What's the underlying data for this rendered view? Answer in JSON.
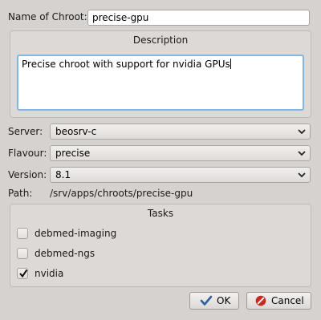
{
  "form": {
    "name_label": "Name of Chroot:",
    "name_value": "precise-gpu",
    "description_title": "Description",
    "description_value": "Precise chroot with support for nvidia GPUs",
    "server_label": "Server:",
    "server_value": "beosrv-c",
    "flavour_label": "Flavour:",
    "flavour_value": "precise",
    "version_label": "Version:",
    "version_value": "8.1",
    "path_label": "Path:",
    "path_value": "/srv/apps/chroots/precise-gpu"
  },
  "tasks": {
    "title": "Tasks",
    "items": [
      {
        "label": "debmed-imaging",
        "checked": false
      },
      {
        "label": "debmed-ngs",
        "checked": false
      },
      {
        "label": "nvidia",
        "checked": true
      }
    ]
  },
  "buttons": {
    "ok_label": "OK",
    "cancel_label": "Cancel"
  },
  "colors": {
    "focus_border": "#7fb8e0",
    "ok_icon": "#2f5f9e",
    "cancel_icon": "#c8281e"
  }
}
